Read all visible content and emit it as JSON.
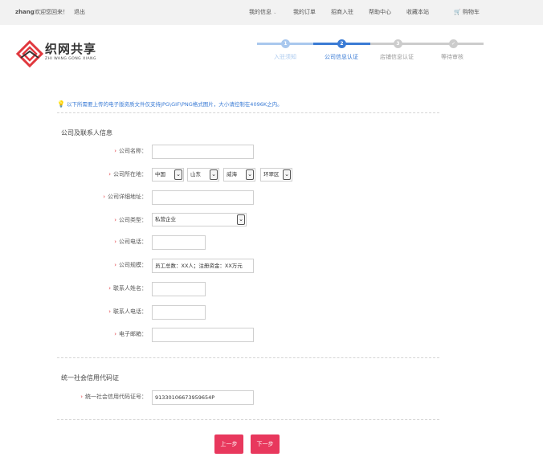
{
  "topbar": {
    "username": "zhang",
    "welcome": "欢迎您回来！",
    "logout": "退出",
    "nav": {
      "my_info": "我的信息",
      "my_orders": "我的订单",
      "join": "招商入驻",
      "help": "帮助中心",
      "bookmark": "收藏本站",
      "cart": "购物车"
    }
  },
  "logo": {
    "text": "织网共享",
    "subtitle": "ZHI WANG GONG XIANG",
    "color": "#e0383e"
  },
  "steps": [
    {
      "num": "1",
      "label": "入驻须知",
      "state": "done"
    },
    {
      "num": "2",
      "label": "公司信息认证",
      "state": "active"
    },
    {
      "num": "3",
      "label": "店铺信息认证",
      "state": "todo"
    },
    {
      "num": "✓",
      "label": "等待审核",
      "state": "todo"
    }
  ],
  "colors": {
    "accent": "#3a7bd5",
    "done": "#a9c8ee",
    "todo": "#cccccc",
    "button": "#e8385d"
  },
  "notice": "以下所需要上传的电子版资质文件仅支持JPG\\GIF\\PNG格式图片，大小请控制在4096K之内。",
  "company_section": {
    "title": "公司及联系人信息",
    "fields": {
      "name": {
        "label": "公司名称：",
        "value": ""
      },
      "location": {
        "label": "公司所在地：",
        "country": "中国",
        "province": "山东",
        "city": "威海",
        "district": "环翠区"
      },
      "address": {
        "label": "公司详细地址：",
        "value": ""
      },
      "type": {
        "label": "公司类型：",
        "value": "私营企业"
      },
      "phone": {
        "label": "公司电话：",
        "value": ""
      },
      "scale": {
        "label": "公司规模：",
        "value": "员工总数：XX人；注册资金：XX万元"
      },
      "contact_name": {
        "label": "联系人姓名：",
        "value": ""
      },
      "contact_phone": {
        "label": "联系人电话：",
        "value": ""
      },
      "email": {
        "label": "电子邮箱：",
        "value": ""
      }
    }
  },
  "credit_section": {
    "title": "统一社会信用代码证",
    "field": {
      "label": "统一社会信用代码证号：",
      "value": "91330106673959654P"
    }
  },
  "buttons": {
    "prev": "上一步",
    "next": "下一步"
  }
}
